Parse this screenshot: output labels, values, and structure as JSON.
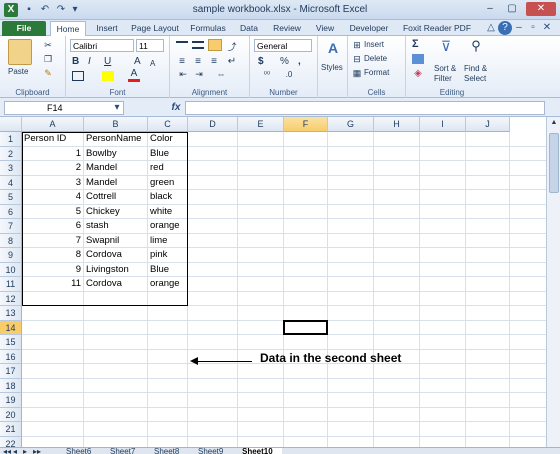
{
  "window": {
    "title": "sample workbook.xlsx - Microsoft Excel",
    "controls": {
      "minimize": "–",
      "maximize": "▢",
      "close": "✕"
    }
  },
  "ribbon_tabs": [
    "File",
    "Home",
    "Insert",
    "Page Layout",
    "Formulas",
    "Data",
    "Review",
    "View",
    "Developer",
    "Foxit Reader PDF"
  ],
  "ribbon": {
    "clipboard": {
      "paste": "Paste",
      "label": "Clipboard"
    },
    "font": {
      "name": "Calibri",
      "size": "11",
      "label": "Font",
      "bold": "B",
      "italic": "I",
      "underline": "U",
      "grow": "A",
      "shrink": "A"
    },
    "alignment": {
      "label": "Alignment"
    },
    "number": {
      "format": "General",
      "currency": "$",
      "percent": "%",
      "comma": ",",
      "label": "Number"
    },
    "styles": {
      "label": "Styles"
    },
    "cells": {
      "insert": "Insert",
      "delete": "Delete",
      "format": "Format",
      "label": "Cells"
    },
    "editing": {
      "sum": "Σ",
      "sort_filter": "Sort &",
      "sort_filter2": "Filter",
      "find_select": "Find &",
      "find_select2": "Select",
      "label": "Editing"
    }
  },
  "formula_bar": {
    "name_box": "F14",
    "fx": "fx",
    "content": ""
  },
  "columns": [
    "A",
    "B",
    "C",
    "D",
    "E",
    "F",
    "G",
    "H",
    "I",
    "J"
  ],
  "rows": [
    "1",
    "2",
    "3",
    "4",
    "5",
    "6",
    "7",
    "8",
    "9",
    "10",
    "11",
    "12",
    "13",
    "14",
    "15",
    "16",
    "17",
    "18",
    "19",
    "20",
    "21",
    "22"
  ],
  "selected": {
    "column": "F",
    "row": "14"
  },
  "headers": {
    "a": "Person ID",
    "b": "PersonName",
    "c": "Color"
  },
  "table": [
    {
      "id": "1",
      "name": "Bowlby",
      "color": "Blue"
    },
    {
      "id": "2",
      "name": "Mandel",
      "color": "red"
    },
    {
      "id": "3",
      "name": "Mandel",
      "color": "green"
    },
    {
      "id": "4",
      "name": "Cottrell",
      "color": "black"
    },
    {
      "id": "5",
      "name": "Chickey",
      "color": "white"
    },
    {
      "id": "6",
      "name": "stash",
      "color": "orange"
    },
    {
      "id": "7",
      "name": "Swapnil",
      "color": "lime"
    },
    {
      "id": "8",
      "name": "Cordova",
      "color": "pink"
    },
    {
      "id": "9",
      "name": "Livingston",
      "color": "Blue"
    },
    {
      "id": "11",
      "name": "Cordova",
      "color": "orange"
    }
  ],
  "annotation": "Data in the second sheet",
  "sheets": [
    "Sheet6",
    "Sheet7",
    "Sheet8",
    "Sheet9",
    "Sheet10"
  ],
  "active_sheet": "Sheet10",
  "colors": {
    "file_tab": "#2c7a3a",
    "selection_header": "#f8cc6b",
    "ribbon_bg": "#e4ecf7"
  }
}
